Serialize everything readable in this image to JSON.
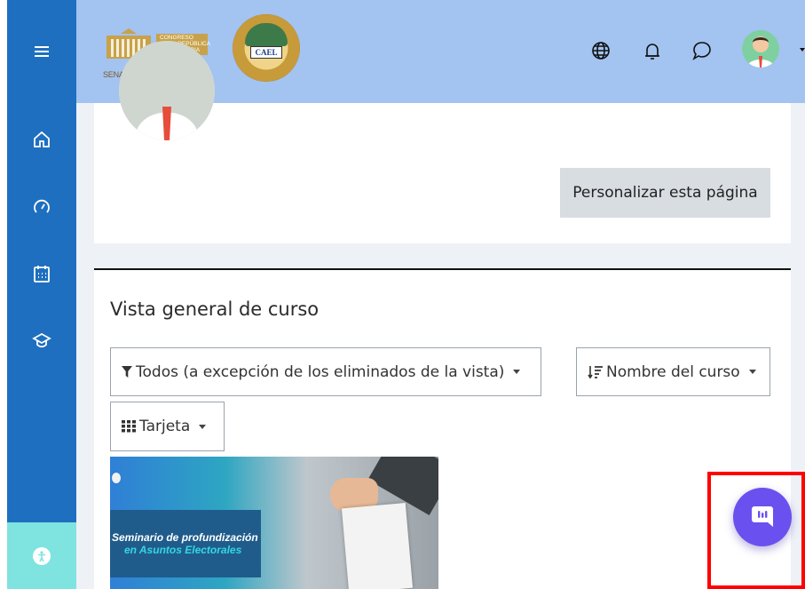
{
  "header": {
    "logo_lines": [
      "CONGRESO",
      "DE LA REPÚBLICA",
      "DE COLOMBIA"
    ],
    "logo_footer": "SENADO DE LA REPÚBLICA",
    "seal_text": "CAEL"
  },
  "sidebar": {
    "items": [
      {
        "icon": "menu-icon"
      },
      {
        "icon": "home-icon"
      },
      {
        "icon": "dashboard-icon"
      },
      {
        "icon": "calendar-icon"
      },
      {
        "icon": "graduation-cap-icon"
      }
    ],
    "accessibility_icon": "accessibility-icon"
  },
  "main": {
    "customize_button": "Personalizar esta página",
    "course_overview": {
      "title": "Vista general de curso",
      "filter_label": "Todos (a excepción de los eliminados de la vista)",
      "sort_label": "Nombre del curso",
      "view_label": "Tarjeta"
    },
    "course_card": {
      "line1": "Seminario de profundización",
      "line2": "en Asuntos Electorales"
    }
  },
  "colors": {
    "sidebar": "#1e6fbf",
    "header": "#a3c3f1",
    "chat_button": "#6b50f0",
    "highlight": "#ff0000",
    "accessibility": "#7fe3e0"
  }
}
